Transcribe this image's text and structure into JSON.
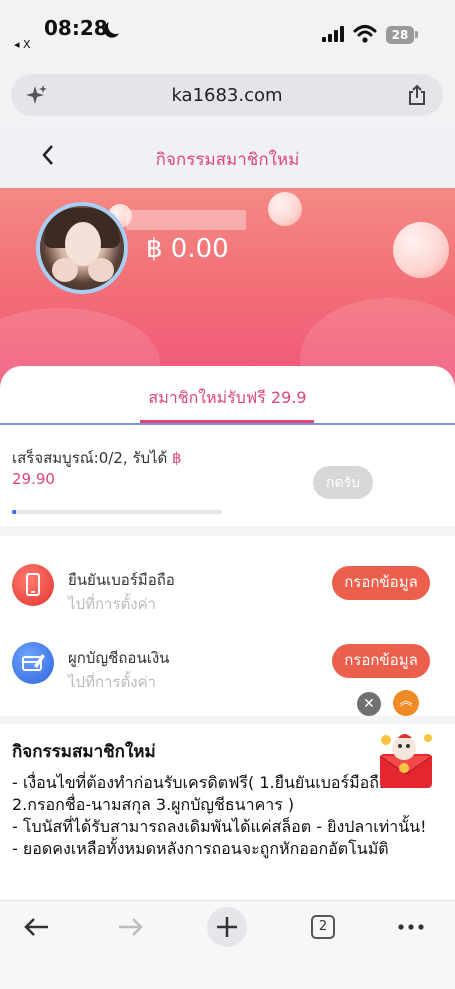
{
  "status_bar": {
    "time": "08:28",
    "back_app": "◂ X",
    "battery": "28"
  },
  "browser": {
    "url": "ka1683.com",
    "tab_count": "2"
  },
  "header": {
    "title": "กิจกรรมสมาชิกใหม่"
  },
  "profile": {
    "balance": "฿ 0.00"
  },
  "tab": {
    "label": "สมาชิกใหม่รับฟรี 29.9"
  },
  "progress": {
    "label": "เสร็จสมบูรณ์:0/2, รับได้ ",
    "currency": "฿",
    "amount": "29.90",
    "claim_label": "กดรับ",
    "completed_fraction": 0.0
  },
  "tasks": [
    {
      "title": "ยืนยันเบอร์มือถือ",
      "subtitle": "ไปที่การตั้งค่า",
      "button": "กรอกข้อมูล",
      "icon": "phone-icon"
    },
    {
      "title": "ผูกบัญชีถอนเงิน",
      "subtitle": "ไปที่การตั้งค่า",
      "button": "กรอกข้อมูล",
      "icon": "card-icon"
    }
  ],
  "floating": {
    "close": "✕",
    "up": "︽"
  },
  "rules": {
    "title": "กิจกรรมสมาชิกใหม่",
    "lines": [
      "- เงื่อนไขที่ต้องทำก่อนรับเครดิตฟรี( 1.ยืนยันเบอร์มือถือ 2.กรอกชื่อ-นามสกุล 3.ผูกบัญชีธนาคาร )",
      "- โบนัสที่ได้รับสามารถลงเดิมพันได้แค่สล็อต - ยิงปลาเท่านั้น!",
      "- ยอดคงเหลือทั้งหมดหลังการถอนจะถูกหักออกอัตโนมัติ"
    ]
  },
  "colors": {
    "accent": "#e0467b",
    "button": "#ec5f4d",
    "banner_top": "#f48a84",
    "banner_bottom": "#f1557a"
  }
}
